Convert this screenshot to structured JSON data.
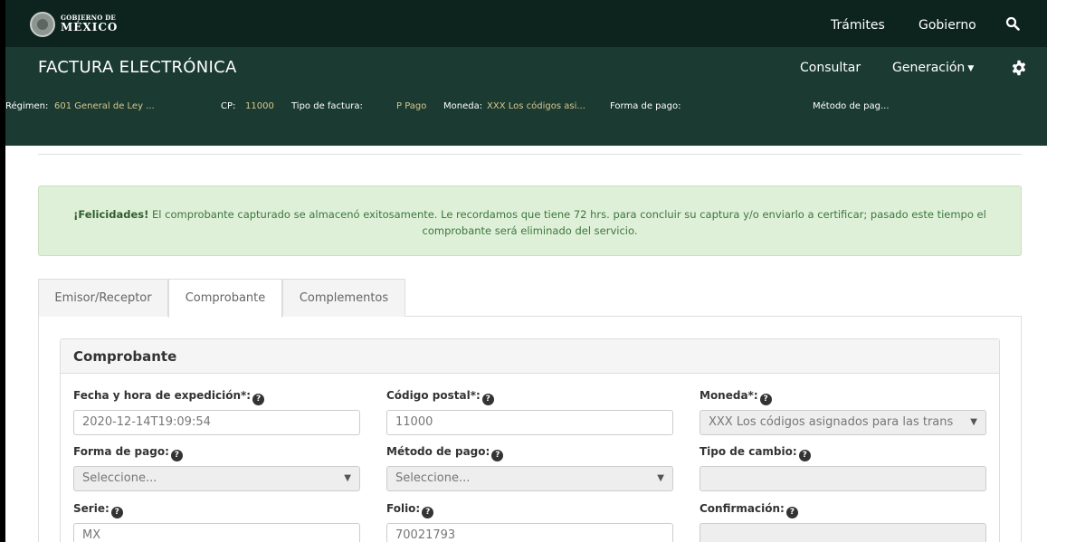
{
  "gov_bar": {
    "brand_small": "GOBIERNO DE",
    "brand_big": "MÉXICO",
    "links": [
      "Trámites",
      "Gobierno"
    ],
    "search_icon": "search-icon"
  },
  "header": {
    "title": "FACTURA ELECTRÓNICA",
    "nav_consultar": "Consultar",
    "nav_generacion": "Generación",
    "settings_icon": "gear-icon",
    "info": {
      "regimen_label": "Régimen:",
      "regimen_value": "601 General de Ley ...",
      "cp_label": "CP:",
      "cp_value": "11000",
      "tipo_label": "Tipo de factura:",
      "tipo_value": "P Pago",
      "moneda_label": "Moneda:",
      "moneda_value": "XXX Los códigos asi...",
      "forma_label": "Forma de pago:",
      "metodo_label": "Método de pag..."
    }
  },
  "alert": {
    "strong": "¡Felicidades!",
    "message": " El comprobante capturado se almacenó exitosamente. Le recordamos que tiene 72 hrs. para concluir su captura y/o enviarlo a certificar; pasado este tiempo el comprobante será eliminado del servicio."
  },
  "tabs": [
    "Emisor/Receptor",
    "Comprobante",
    "Complementos"
  ],
  "panel": {
    "title": "Comprobante",
    "fields": {
      "fecha_label": "Fecha y hora de expedición*:",
      "fecha_value": "2020-12-14T19:09:54",
      "cp_label": "Código postal*:",
      "cp_value": "11000",
      "moneda_label": "Moneda*:",
      "moneda_value": "XXX Los códigos asignados para las trans",
      "forma_label": "Forma de pago:",
      "forma_value": "Seleccione...",
      "metodo_label": "Método de pago:",
      "metodo_value": "Seleccione...",
      "tipo_cambio_label": "Tipo de cambio:",
      "tipo_cambio_value": "",
      "serie_label": "Serie:",
      "serie_value": "MX",
      "folio_label": "Folio:",
      "folio_value": "70021793",
      "confirmacion_label": "Confirmación:",
      "confirmacion_value": ""
    }
  }
}
